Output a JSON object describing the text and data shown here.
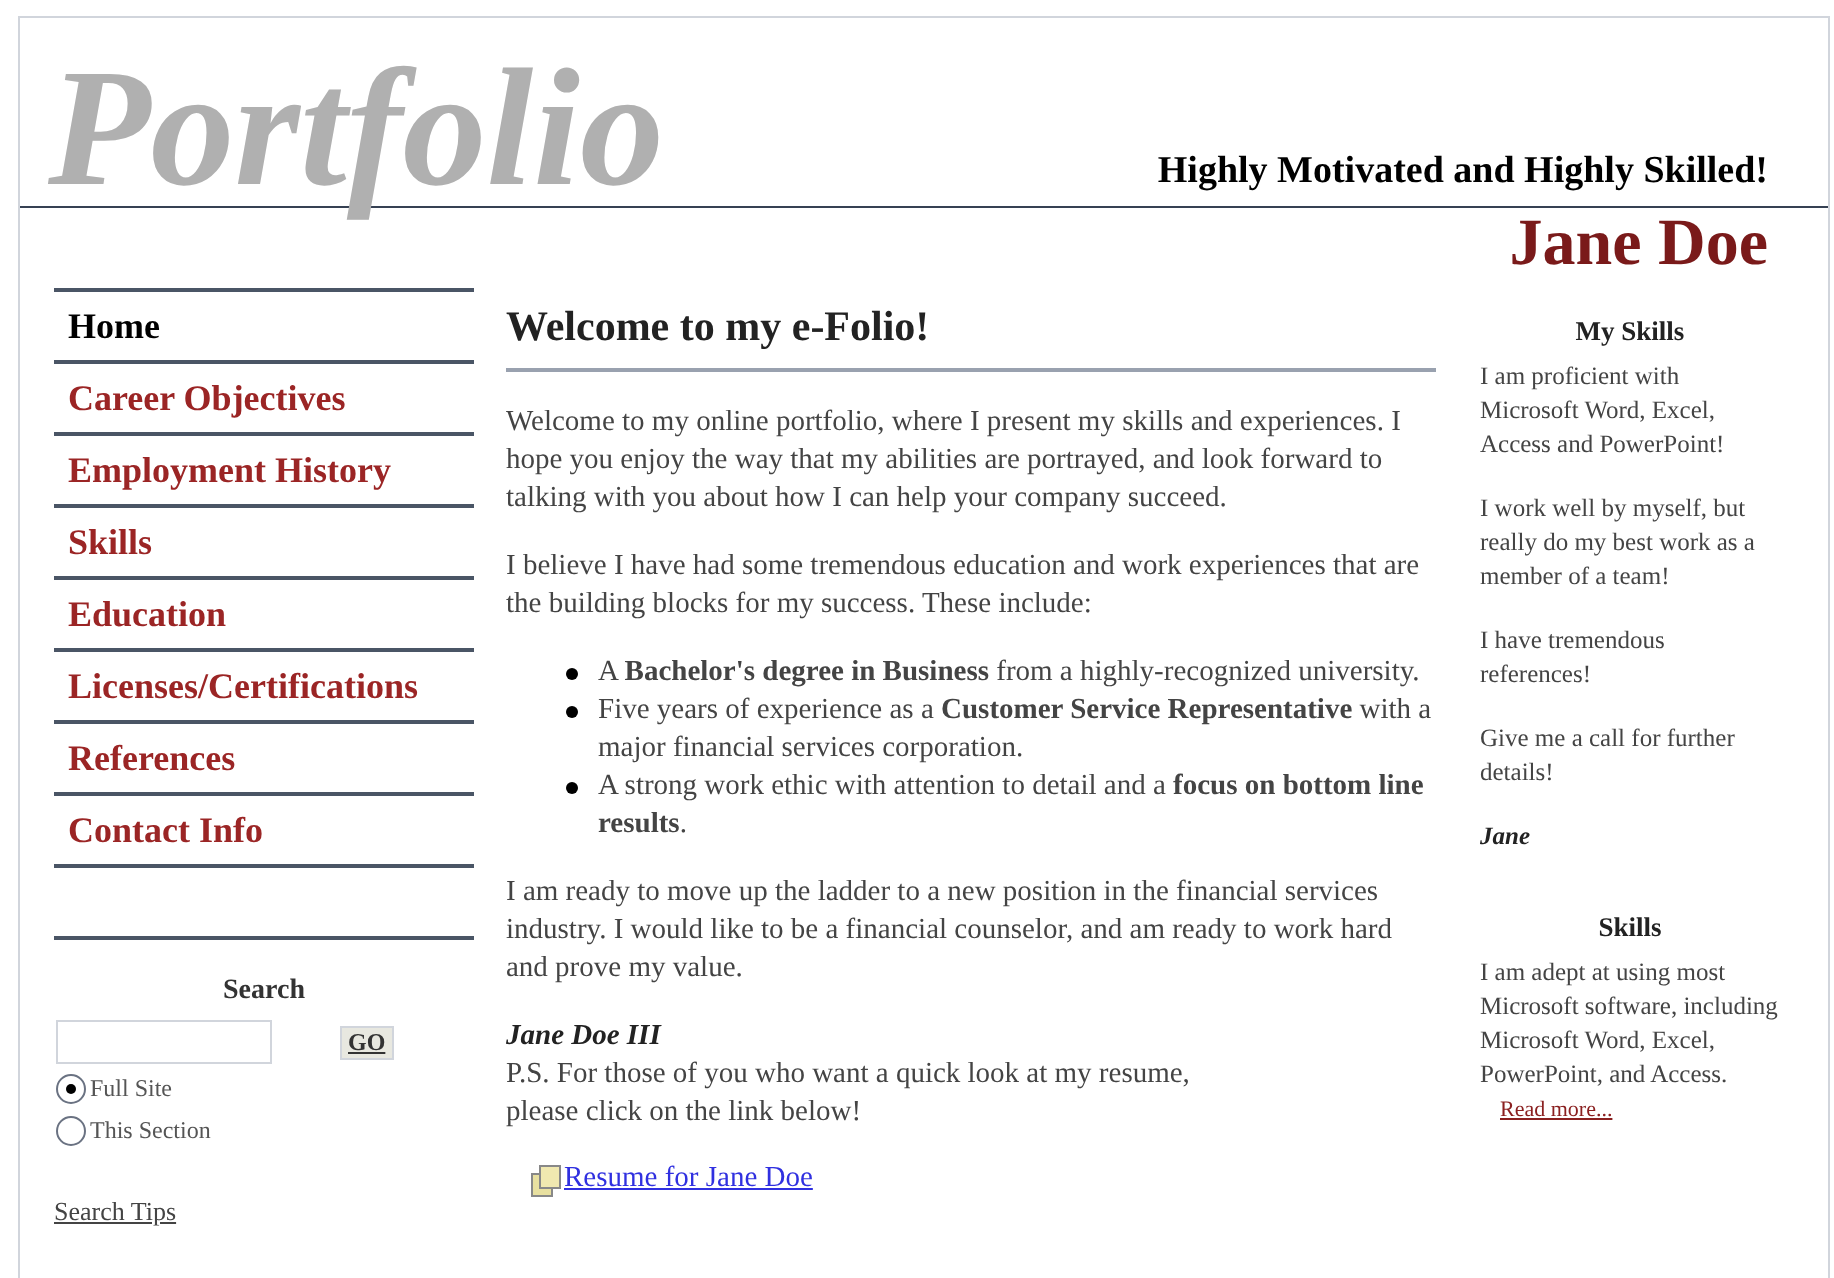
{
  "header": {
    "logo": "Portfolio",
    "tagline": "Highly Motivated and Highly Skilled!",
    "name": "Jane Doe"
  },
  "nav": [
    {
      "label": "Home",
      "selected": true
    },
    {
      "label": "Career Objectives",
      "selected": false
    },
    {
      "label": "Employment History",
      "selected": false
    },
    {
      "label": "Skills",
      "selected": false
    },
    {
      "label": "Education",
      "selected": false
    },
    {
      "label": "Licenses/Certifications",
      "selected": false
    },
    {
      "label": "References",
      "selected": false
    },
    {
      "label": "Contact Info",
      "selected": false
    }
  ],
  "search": {
    "title": "Search",
    "button": "GO",
    "scopes": [
      {
        "label": "Full Site",
        "selected": true
      },
      {
        "label": "This Section",
        "selected": false
      }
    ],
    "tips_link": "Search Tips"
  },
  "main": {
    "heading": "Welcome to my e-Folio!",
    "intro": [
      "Welcome to my online portfolio, where I present my skills and experiences. I hope you enjoy the way that my abilities are portrayed, and look forward to talking with you about how I can help your company succeed.",
      "I believe I have had some tremendous education and work experiences that are the building blocks for my success.  These include:"
    ],
    "bullets": [
      "A **Bachelor's degree in Business** from a highly-recognized university.",
      "Five years of experience as a **Customer Service Representative** with a major financial services corporation.",
      "A strong work ethic with attention to detail and a **focus on bottom line results**."
    ],
    "closing": "I am ready to move up the ladder to a new position in the financial services industry.  I would like to be a financial counselor, and am ready to work hard and prove my value.",
    "signature": "Jane Doe III",
    "ps": [
      "P.S. For those of you who want a quick look at my resume,",
      "please click on the link below!"
    ],
    "resume_link": "Resume for Jane Doe"
  },
  "sidebar": [
    {
      "title": "My Skills",
      "paragraphs": [
        "I am proficient with Microsoft Word, Excel, Access and PowerPoint!",
        "I work well by myself, but really do my best work as a member of a team!",
        "I have tremendous references!",
        "Give me a call for further details!"
      ],
      "signature": "Jane"
    },
    {
      "title": "Skills",
      "paragraphs": [
        "I am adept at using most Microsoft software, including Microsoft Word, Excel, PowerPoint, and Access."
      ],
      "link": "Read more..."
    }
  ]
}
